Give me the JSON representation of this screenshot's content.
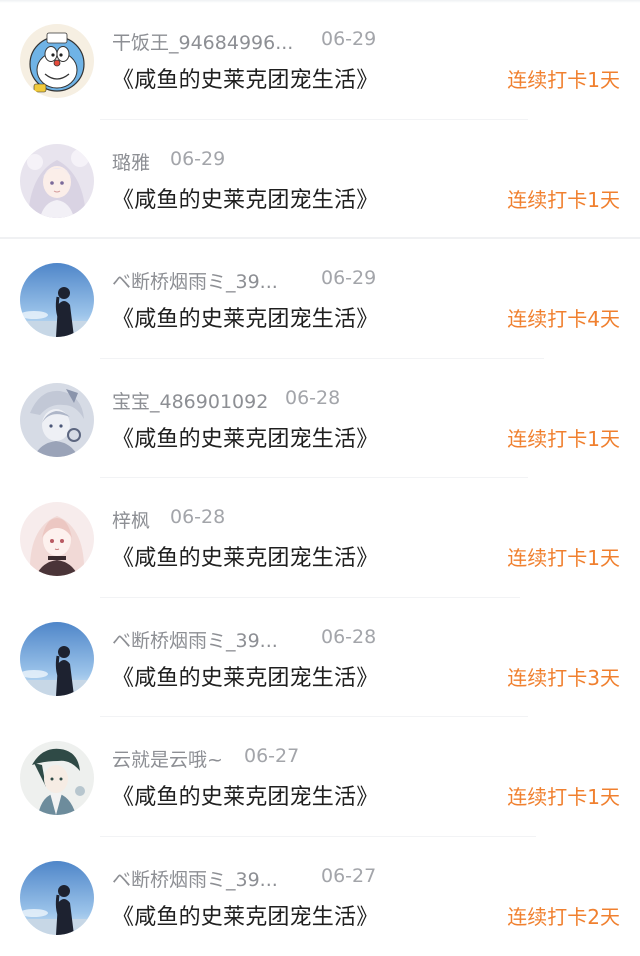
{
  "colors": {
    "streak_accent": "#f0802f",
    "meta_text": "#8d8f94",
    "title_text": "#1f1f1f",
    "divider": "#f2f3f5"
  },
  "feed": {
    "items": [
      {
        "avatar_icon": "doraemon-avatar-icon",
        "username": "干饭王_94684996...",
        "date": "06-29",
        "book_title": "《咸鱼的史莱克团宠生活》",
        "streak": "连续打卡1天"
      },
      {
        "avatar_icon": "anime-girl-avatar-icon",
        "username": "璐雅",
        "date": "06-29",
        "book_title": "《咸鱼的史莱克团宠生活》",
        "streak": "连续打卡1天"
      },
      {
        "avatar_icon": "sky-silhouette-avatar-icon",
        "username": "ベ断桥烟雨ミ_39...",
        "date": "06-29",
        "book_title": "《咸鱼的史莱克团宠生活》",
        "streak": "连续打卡4天"
      },
      {
        "avatar_icon": "anime-boy-avatar-icon",
        "username": "宝宝_486901092",
        "date": "06-28",
        "book_title": "《咸鱼的史莱克团宠生活》",
        "streak": "连续打卡1天"
      },
      {
        "avatar_icon": "anime-girl-pink-avatar-icon",
        "username": "梓枫",
        "date": "06-28",
        "book_title": "《咸鱼的史莱克团宠生活》",
        "streak": "连续打卡1天"
      },
      {
        "avatar_icon": "sky-silhouette-avatar-icon",
        "username": "ベ断桥烟雨ミ_39...",
        "date": "06-28",
        "book_title": "《咸鱼的史莱克团宠生活》",
        "streak": "连续打卡3天"
      },
      {
        "avatar_icon": "anime-character-avatar-icon",
        "username": "云就是云哦~",
        "date": "06-27",
        "book_title": "《咸鱼的史莱克团宠生活》",
        "streak": "连续打卡1天"
      },
      {
        "avatar_icon": "sky-silhouette-avatar-icon",
        "username": "ベ断桥烟雨ミ_39...",
        "date": "06-27",
        "book_title": "《咸鱼的史莱克团宠生活》",
        "streak": "连续打卡2天"
      }
    ]
  }
}
